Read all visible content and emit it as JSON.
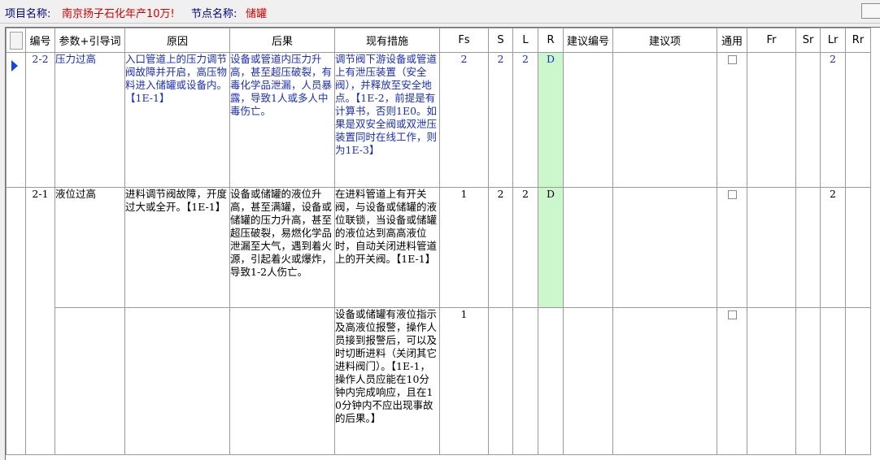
{
  "header": {
    "project_label": "项目名称:",
    "project_value": "南京扬子石化年产10万!",
    "node_label": "节点名称:",
    "node_value": "储罐"
  },
  "columns": [
    "编号",
    "参数+引导词",
    "原因",
    "后果",
    "现有措施",
    "Fs",
    "S",
    "L",
    "R",
    "建议编号",
    "建议项",
    "通用",
    "Fr",
    "Sr",
    "Lr",
    "Rr"
  ],
  "rows": [
    {
      "id": "2-2",
      "param": "压力过高",
      "cause": "入口管道上的压力调节阀故障并开启，高压物料进入储罐或设备内。【1E-1】",
      "consequence": "设备或管道内压力升高，甚至超压破裂，有毒化学品泄漏，人员暴露，导致1人或多人中毒伤亡。",
      "measures": [
        {
          "text": "调节阀下游设备或管道上有泄压装置（安全阀），并释放至安全地点。【1E-2，前提是有计算书，否则1E0。如果是双安全阀或双泄压装置同时在线工作，则为1E-3】",
          "fs": "2"
        }
      ],
      "S": "2",
      "L": "2",
      "R": "D",
      "Lr": "2"
    },
    {
      "id": "2-1",
      "param": "液位过高",
      "cause": "进料调节阀故障，开度过大或全开。【1E-1】",
      "consequence": "设备或储罐的液位升高，甚至满罐，设备或储罐的压力升高，甚至超压破裂，易燃化学品泄漏至大气，遇到着火源，引起着火或爆炸，导致1-2人伤亡。",
      "measures": [
        {
          "text": "在进料管道上有开关阀，与设备或储罐的液位联锁，当设备或储罐的液位达到高高液位时，自动关闭进料管道上的开关阀。【1E-1】",
          "fs": "1"
        },
        {
          "text": "设备或储罐有液位指示及高液位报警，操作人员接到报警后，可以及时切断进料（关闭其它进料阀门）。【1E-1，操作人员应能在10分钟内完成响应，且在10分钟内不应出现事故的后果。】",
          "fs": "1"
        }
      ],
      "S": "2",
      "L": "2",
      "R": "D",
      "Lr": "2"
    }
  ]
}
